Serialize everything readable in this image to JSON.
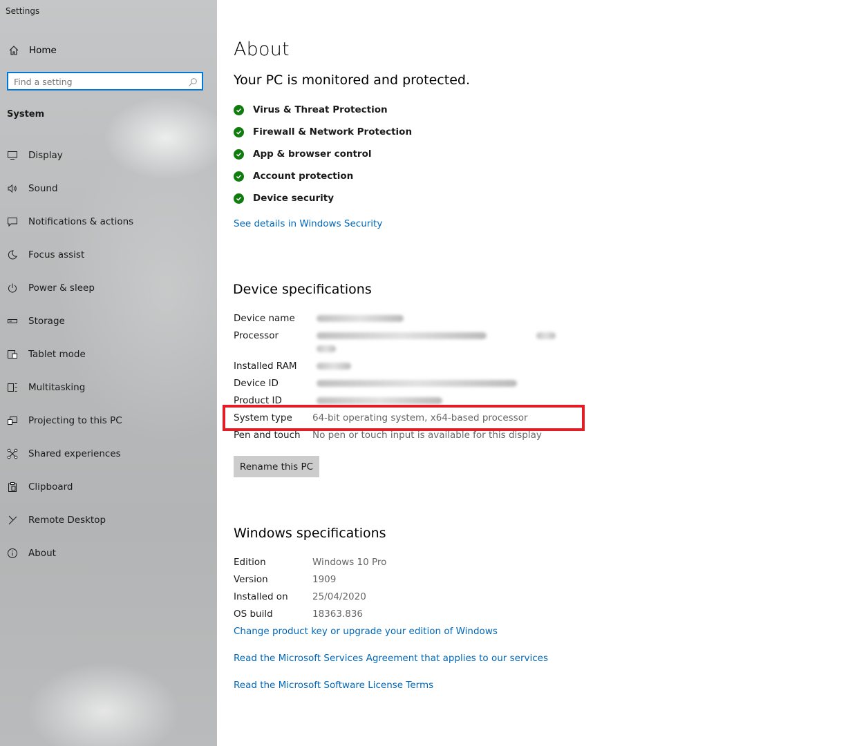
{
  "window": {
    "title": "Settings"
  },
  "sidebar": {
    "home_label": "Home",
    "search_placeholder": "Find a setting",
    "section_title": "System",
    "items": [
      {
        "label": "Display",
        "icon": "monitor-icon"
      },
      {
        "label": "Sound",
        "icon": "speaker-icon"
      },
      {
        "label": "Notifications & actions",
        "icon": "notification-icon"
      },
      {
        "label": "Focus assist",
        "icon": "moon-icon"
      },
      {
        "label": "Power & sleep",
        "icon": "power-icon"
      },
      {
        "label": "Storage",
        "icon": "storage-icon"
      },
      {
        "label": "Tablet mode",
        "icon": "tablet-icon"
      },
      {
        "label": "Multitasking",
        "icon": "multitasking-icon"
      },
      {
        "label": "Projecting to this PC",
        "icon": "projecting-icon"
      },
      {
        "label": "Shared experiences",
        "icon": "shared-icon"
      },
      {
        "label": "Clipboard",
        "icon": "clipboard-icon"
      },
      {
        "label": "Remote Desktop",
        "icon": "remote-desktop-icon"
      },
      {
        "label": "About",
        "icon": "info-icon"
      }
    ]
  },
  "main": {
    "title": "About",
    "protection": {
      "heading": "Your PC is monitored and protected.",
      "items": [
        "Virus & Threat Protection",
        "Firewall & Network Protection",
        "App & browser control",
        "Account protection",
        "Device security"
      ],
      "link": "See details in Windows Security"
    },
    "device_specs": {
      "heading": "Device specifications",
      "rows": [
        {
          "key": "Device name",
          "value": ""
        },
        {
          "key": "Processor",
          "value": ""
        },
        {
          "key": "Installed RAM",
          "value": ""
        },
        {
          "key": "Device ID",
          "value": ""
        },
        {
          "key": "Product ID",
          "value": ""
        },
        {
          "key": "System type",
          "value": "64-bit operating system, x64-based processor"
        },
        {
          "key": "Pen and touch",
          "value": "No pen or touch input is available for this display"
        }
      ],
      "rename_button": "Rename this PC"
    },
    "windows_specs": {
      "heading": "Windows specifications",
      "rows": [
        {
          "key": "Edition",
          "value": "Windows 10 Pro"
        },
        {
          "key": "Version",
          "value": "1909"
        },
        {
          "key": "Installed on",
          "value": "25/04/2020"
        },
        {
          "key": "OS build",
          "value": "18363.836"
        }
      ],
      "links": [
        "Change product key or upgrade your edition of Windows",
        "Read the Microsoft Services Agreement that applies to our services",
        "Read the Microsoft Software License Terms"
      ]
    }
  },
  "colors": {
    "accent": "#0078d7",
    "link": "#0067b8",
    "check": "#107c10",
    "highlight": "#e11d25"
  }
}
